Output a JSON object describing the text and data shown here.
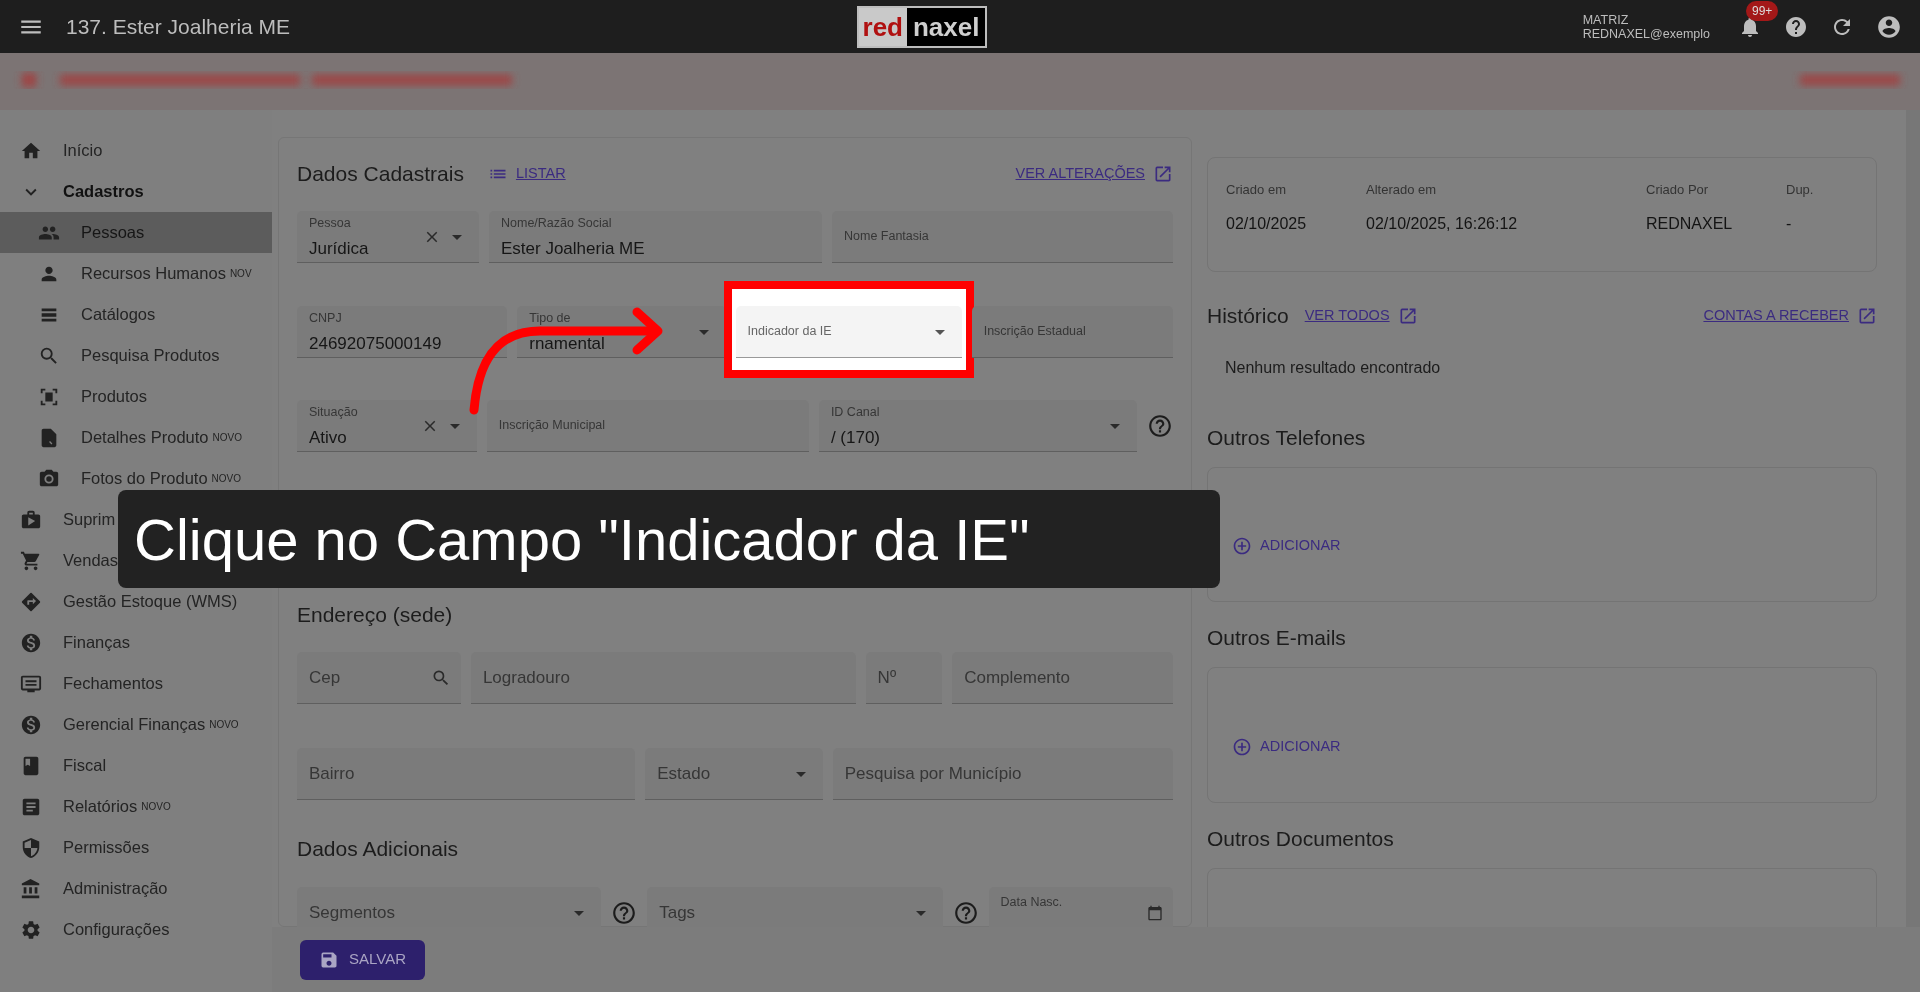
{
  "top_bar": {
    "title": "137. Ester Joalheria ME",
    "logo": {
      "part_1": "red",
      "part_2": "naxel"
    },
    "branch": "MATRIZ",
    "user": "REDNAXEL@exemplo",
    "notifications_badge": "99+"
  },
  "sidebar": {
    "items": [
      {
        "label": "Início",
        "selected": false
      },
      {
        "label": "Cadastros",
        "selected": false,
        "expanded": true,
        "children": [
          {
            "label": "Pessoas",
            "selected": true
          },
          {
            "label": "Recursos Humanos",
            "badge": "NOV",
            "selected": false
          },
          {
            "label": "Catálogos",
            "selected": false
          },
          {
            "label": "Pesquisa Produtos",
            "selected": false
          },
          {
            "label": "Produtos",
            "selected": false
          },
          {
            "label": "Detalhes Produto",
            "badge": "NOVO",
            "selected": false
          },
          {
            "label": "Fotos do Produto",
            "badge": "NOVO",
            "selected": false
          }
        ]
      },
      {
        "label": "Suprim",
        "selected": false
      },
      {
        "label": "Vendas",
        "selected": false
      },
      {
        "label": "Gestão Estoque (WMS)",
        "selected": false
      },
      {
        "label": "Finanças",
        "selected": false
      },
      {
        "label": "Fechamentos",
        "selected": false
      },
      {
        "label": "Gerencial Finanças",
        "badge": "NOVO",
        "selected": false
      },
      {
        "label": "Fiscal",
        "selected": false
      },
      {
        "label": "Relatórios",
        "badge": "NOVO",
        "selected": false
      },
      {
        "label": "Permissões",
        "selected": false
      },
      {
        "label": "Administração",
        "selected": false
      },
      {
        "label": "Configurações",
        "selected": false
      }
    ]
  },
  "form": {
    "title": "Dados Cadastrais",
    "list_link": "LISTAR",
    "changes_link": "VER ALTERAÇÕES",
    "rows": [
      [
        {
          "kind": "select",
          "label": "Pessoa",
          "value": "Jurídica",
          "clearable": true,
          "highlighted": false
        },
        {
          "kind": "text",
          "label": "Nome/Razão Social",
          "value": "Ester Joalheria ME",
          "highlighted": false
        },
        {
          "kind": "text",
          "label": "Nome Fantasia",
          "highlighted": false
        }
      ],
      [
        {
          "kind": "text",
          "label": "CNPJ",
          "value": "24692075000149",
          "highlighted": false
        },
        {
          "kind": "select",
          "label": "Tipo de",
          "value": "rnamental",
          "highlighted": false
        },
        {
          "kind": "select",
          "label": "Indicador da IE",
          "highlighted": true
        },
        {
          "kind": "text",
          "label": "Inscrição Estadual",
          "highlighted": false
        }
      ],
      [
        {
          "kind": "select",
          "label": "Situação",
          "value": "Ativo",
          "clearable": true,
          "highlighted": false
        },
        {
          "kind": "text",
          "label": "Inscrição Municipal",
          "highlighted": false
        },
        {
          "kind": "select",
          "label": "ID Canal",
          "value": "/ (170)",
          "help": true,
          "highlighted": false
        }
      ]
    ]
  },
  "address": {
    "title": "Endereço (sede)",
    "rows": [
      [
        {
          "kind": "search",
          "placeholder": "Cep",
          "highlighted": false
        },
        {
          "kind": "text",
          "placeholder": "Logradouro",
          "highlighted": false
        },
        {
          "kind": "text",
          "placeholder": "Nº",
          "highlighted": false
        },
        {
          "kind": "text",
          "placeholder": "Complemento",
          "highlighted": false
        }
      ],
      [
        {
          "kind": "text",
          "placeholder": "Bairro",
          "highlighted": false
        },
        {
          "kind": "select",
          "placeholder": "Estado",
          "highlighted": false
        },
        {
          "kind": "text",
          "placeholder": "Pesquisa por Município",
          "highlighted": false
        }
      ]
    ]
  },
  "additional": {
    "title": "Dados Adicionais",
    "rows": [
      [
        {
          "kind": "select",
          "placeholder": "Segmentos",
          "help": true,
          "highlighted": false
        },
        {
          "kind": "select",
          "placeholder": "Tags",
          "help": true,
          "highlighted": false
        },
        {
          "kind": "date",
          "label": "Data Nasc.",
          "highlighted": false
        }
      ]
    ]
  },
  "save_button": "SALVAR",
  "record_info": {
    "columns": [
      {
        "label": "Criado em",
        "value": "02/10/2025"
      },
      {
        "label": "Alterado em",
        "value": "02/10/2025, 16:26:12"
      },
      {
        "label": "Criado Por",
        "value": "REDNAXEL"
      },
      {
        "label": "Dup.",
        "value": "-"
      }
    ]
  },
  "history": {
    "title": "Histórico",
    "view_all": "VER TODOS",
    "receivables_link": "CONTAS A RECEBER",
    "empty_text": "Nenhum resultado encontrado"
  },
  "phones": {
    "title": "Outros Telefones",
    "add_button": "ADICIONAR"
  },
  "emails": {
    "title": "Outros E-mails",
    "add_button": "ADICIONAR"
  },
  "documents": {
    "title": "Outros Documentos"
  },
  "tutorial": {
    "caption": "Clique no Campo \"Indicador da IE\""
  }
}
